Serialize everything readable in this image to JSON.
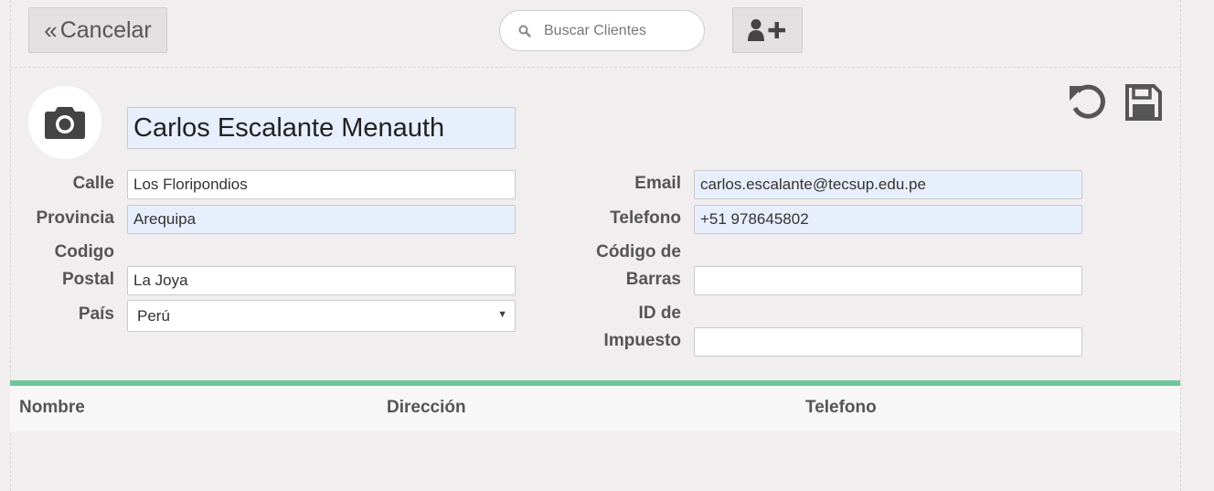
{
  "toolbar": {
    "cancel_label": "Cancelar",
    "search_placeholder": "Buscar Clientes",
    "icons": [
      "angle-double-left-icon",
      "search-icon",
      "user-plus-icon",
      "undo-icon",
      "save-icon",
      "camera-icon"
    ]
  },
  "customer": {
    "name": "Carlos Escalante Menauth",
    "left_fields": [
      {
        "label": "Calle",
        "value": "Los Floripondios"
      },
      {
        "label": "Provincia",
        "value": "Arequipa"
      },
      {
        "label_line1": "Codigo",
        "label_line2": "Postal",
        "value": "La Joya"
      },
      {
        "label": "País",
        "value": "Perú"
      }
    ],
    "right_fields": [
      {
        "label": "Email",
        "value": "carlos.escalante@tecsup.edu.pe"
      },
      {
        "label": "Telefono",
        "value": "+51 978645802"
      },
      {
        "label_line1": "Código de",
        "label_line2": "Barras",
        "value": ""
      },
      {
        "label_line1": "ID de",
        "label_line2": "Impuesto",
        "value": ""
      }
    ]
  },
  "table": {
    "columns": [
      "Nombre",
      "Dirección",
      "Telefono"
    ]
  },
  "colors": {
    "background": "#f0eeee",
    "accent_bar": "#6dc59a",
    "autofill_field": "#e8effc"
  }
}
